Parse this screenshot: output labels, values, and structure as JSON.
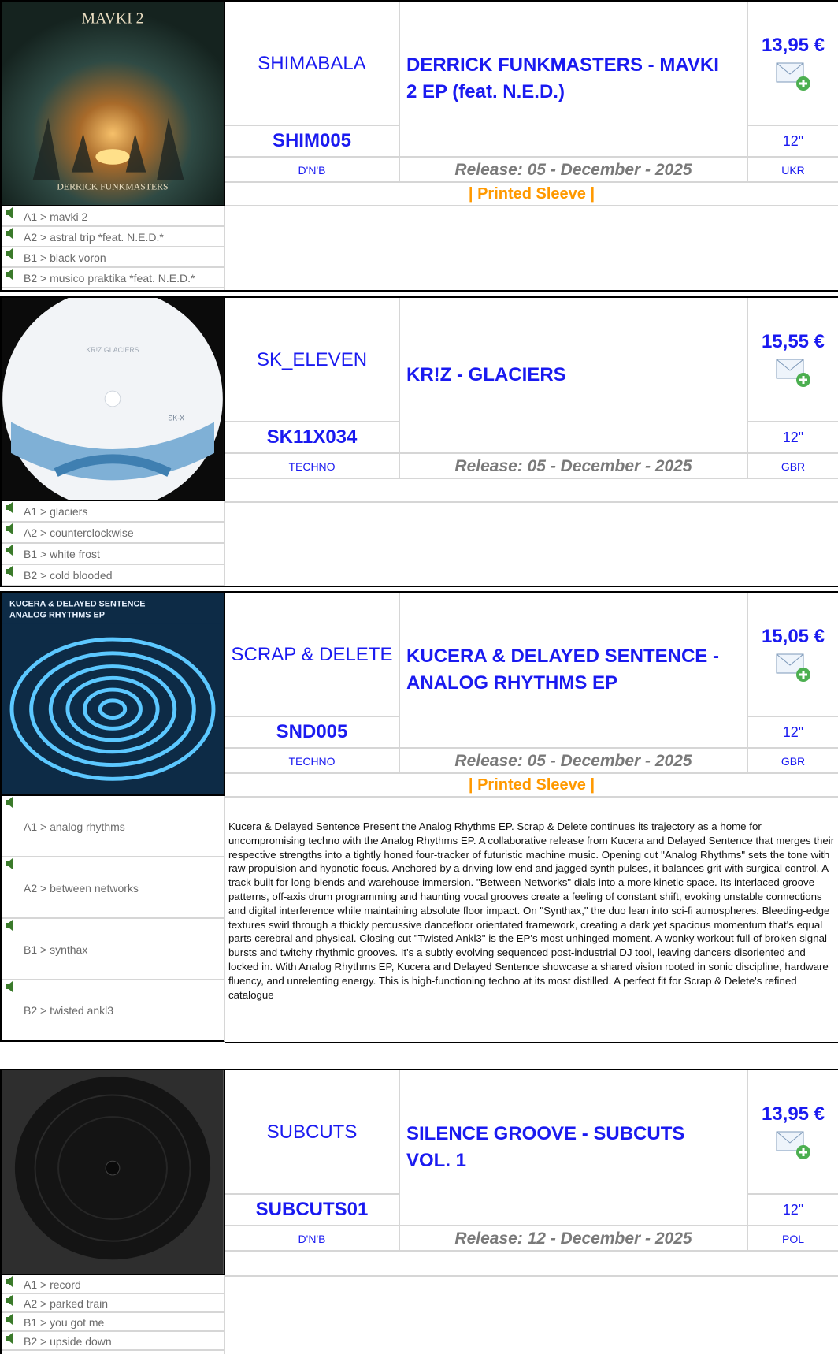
{
  "entries": [
    {
      "label": "SHIMABALA",
      "catno": "SHIM005",
      "genre": "D'N'B",
      "title": "DERRICK FUNKMASTERS - MAVKI 2 EP (feat. N.E.D.)",
      "price": "13,95 €",
      "format": "12\"",
      "country": "UKR",
      "release": "Release: 05 - December - 2025",
      "sleeve": "| Printed Sleeve |",
      "cover_text_top": "MAVKI 2",
      "cover_text_bottom": "DERRICK FUNKMASTERS",
      "tracks": [
        "A1 > mavki 2",
        "A2 > astral trip *feat. N.E.D.*",
        "B1 > black voron",
        "B2 > musico praktika *feat. N.E.D.*"
      ]
    },
    {
      "label": "SK_ELEVEN",
      "catno": "SK11X034",
      "genre": "TECHNO",
      "title": "KR!Z - GLACIERS",
      "price": "15,55 €",
      "format": "12\"",
      "country": "GBR",
      "release": "Release: 05 - December - 2025",
      "cover_text_top": "KR!Z GLACIERS",
      "cover_text_bottom": "SK-X",
      "tracks": [
        "A1 > glaciers",
        "A2 > counterclockwise",
        "B1 > white frost",
        "B2 > cold blooded"
      ]
    },
    {
      "label": "SCRAP & DELETE",
      "catno": "SND005",
      "genre": "TECHNO",
      "title": "KUCERA & DELAYED SENTENCE - ANALOG RHYTHMS EP",
      "price": "15,05 €",
      "format": "12\"",
      "country": "GBR",
      "release": "Release: 05 - December - 2025",
      "sleeve": "| Printed Sleeve |",
      "cover_text_top": "KUCERA & DELAYED SENTENCE",
      "cover_text_bottom": "ANALOG RHYTHMS EP",
      "tracks": [
        "A1 > analog rhythms",
        "A2 > between networks",
        "B1 > synthax",
        "B2 > twisted ankl3"
      ],
      "description": "Kucera & Delayed Sentence Present the Analog Rhythms EP. Scrap & Delete continues its trajectory as a home for uncompromising techno with the Analog Rhythms EP. A collaborative release from Kucera and Delayed Sentence that merges their respective strengths into a tightly honed four-tracker of futuristic machine music. Opening cut \"Analog Rhythms\" sets the tone with raw propulsion and hypnotic focus. Anchored by a driving low end and jagged synth pulses, it balances grit with surgical control. A track built for long blends and warehouse immersion. \"Between Networks\" dials into a more kinetic space. Its interlaced groove patterns, off-axis drum programming and haunting vocal grooves create a feeling of constant shift, evoking unstable connections and digital interference while maintaining absolute floor impact. On \"Synthax,\" the duo lean into sci-fi atmospheres. Bleeding-edge textures swirl through a thickly percussive dancefloor orientated framework, creating a dark yet spacious momentum that's equal parts cerebral and physical. Closing cut \"Twisted Ankl3\" is the EP's most unhinged moment. A wonky workout full of broken signal bursts and twitchy rhythmic grooves. It's a subtly evolving sequenced post-industrial DJ tool, leaving dancers disoriented and locked in. With Analog Rhythms EP, Kucera and Delayed Sentence showcase a shared vision rooted in sonic discipline, hardware fluency, and unrelenting energy. This is high-functioning techno at its most distilled. A perfect fit for Scrap & Delete's refined catalogue"
    },
    {
      "label": "SUBCUTS",
      "catno": "SUBCUTS01",
      "genre": "D'N'B",
      "title": "SILENCE GROOVE - SUBCUTS VOL. 1",
      "price": "13,95 €",
      "format": "12\"",
      "country": "POL",
      "release": "Release: 12 - December - 2025",
      "tracks": [
        "A1 > record",
        "A2 > parked train",
        "B1 > you got me",
        "B2 > upside down"
      ]
    }
  ]
}
